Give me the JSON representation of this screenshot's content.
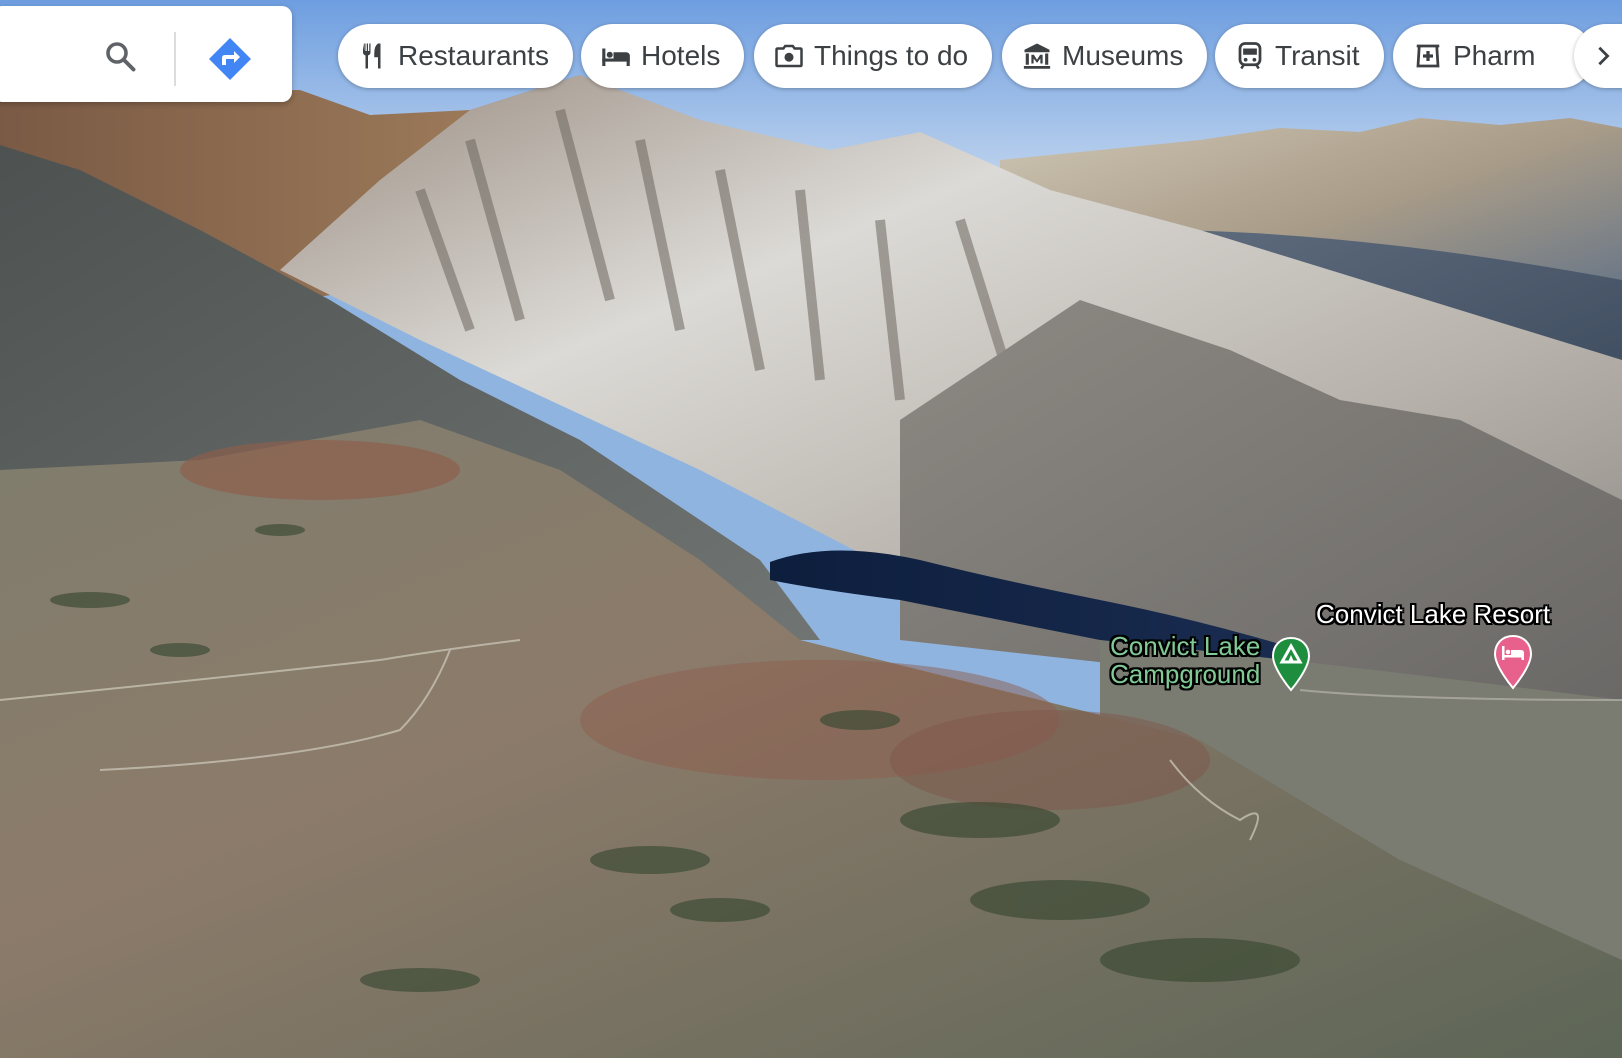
{
  "search": {
    "value": "",
    "placeholder": "",
    "search_icon": "search-icon",
    "directions_icon": "directions-icon",
    "brand_color": "#4285f4"
  },
  "categories": [
    {
      "label": "Restaurants",
      "icon": "fork-knife-icon"
    },
    {
      "label": "Hotels",
      "icon": "bed-icon"
    },
    {
      "label": "Things to do",
      "icon": "camera-icon"
    },
    {
      "label": "Museums",
      "icon": "museum-icon"
    },
    {
      "label": "Transit",
      "icon": "train-icon"
    },
    {
      "label": "Pharm",
      "icon": "pharmacy-icon"
    }
  ],
  "more_icon": "chevron-right-icon",
  "places": {
    "campground": {
      "line1": "Convict Lake",
      "line2": "Campground",
      "color": "#81c995",
      "pin_color": "#1e8e3e",
      "icon": "campground-pin-icon"
    },
    "resort": {
      "name": "Convict Lake Resort",
      "color": "#ffffff",
      "pin_color": "#e8618c",
      "icon": "hotel-pin-icon"
    }
  }
}
